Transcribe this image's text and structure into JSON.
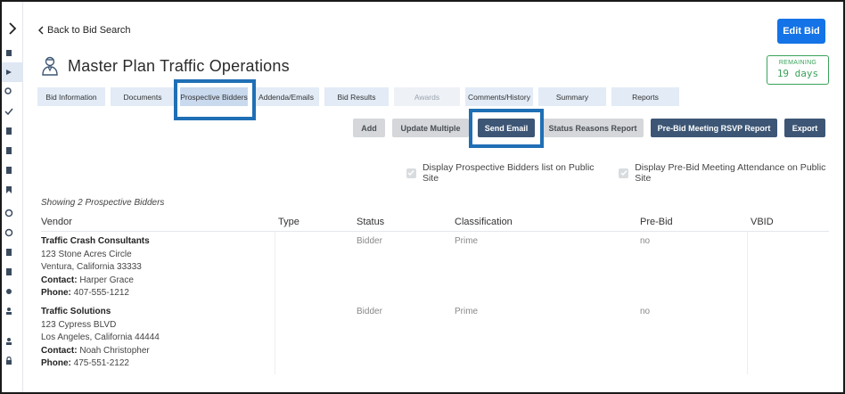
{
  "nav": {
    "back_label": "Back to Bid Search"
  },
  "header": {
    "title": "Master Plan Traffic Operations",
    "edit_label": "Edit Bid"
  },
  "remaining": {
    "label": "REMAINING",
    "value": "19 days"
  },
  "tabs": [
    {
      "label": "Bid Information"
    },
    {
      "label": "Documents"
    },
    {
      "label": "Prospective Bidders"
    },
    {
      "label": "Addenda/Emails"
    },
    {
      "label": "Bid Results"
    },
    {
      "label": "Awards"
    },
    {
      "label": "Comments/History"
    },
    {
      "label": "Summary"
    },
    {
      "label": "Reports"
    }
  ],
  "actions": {
    "add": "Add",
    "update_multiple": "Update Multiple",
    "send_email": "Send Email",
    "status_reasons": "Status Reasons Report",
    "prebid_rsvp": "Pre-Bid Meeting RSVP Report",
    "export": "Export"
  },
  "options": {
    "display_bidders": "Display Prospective Bidders list on Public Site",
    "display_attendance": "Display Pre-Bid Meeting Attendance on Public Site"
  },
  "summary": "Showing 2 Prospective Bidders",
  "table": {
    "headers": {
      "vendor": "Vendor",
      "type": "Type",
      "status": "Status",
      "classification": "Classification",
      "prebid": "Pre-Bid",
      "vbid": "VBID"
    },
    "rows": [
      {
        "name": "Traffic Crash Consultants",
        "address1": "123 Stone Acres Circle",
        "address2": "Ventura, California 33333",
        "contact_label": "Contact:",
        "contact": "Harper Grace",
        "phone_label": "Phone:",
        "phone": "407-555-1212",
        "type": "",
        "status": "Bidder",
        "classification": "Prime",
        "prebid": "no",
        "vbid": ""
      },
      {
        "name": "Traffic Solutions",
        "address1": "123 Cypress BLVD",
        "address2": "Los Angeles, California 44444",
        "contact_label": "Contact:",
        "contact": "Noah Christopher",
        "phone_label": "Phone:",
        "phone": "475-551-2122",
        "type": "",
        "status": "Bidder",
        "classification": "Prime",
        "prebid": "no",
        "vbid": ""
      }
    ]
  },
  "colors": {
    "primary": "#1473e6",
    "highlight": "#1f6fb5",
    "navy": "#3d5675",
    "success": "#3aa35a",
    "tab": "#e2ebf6"
  }
}
